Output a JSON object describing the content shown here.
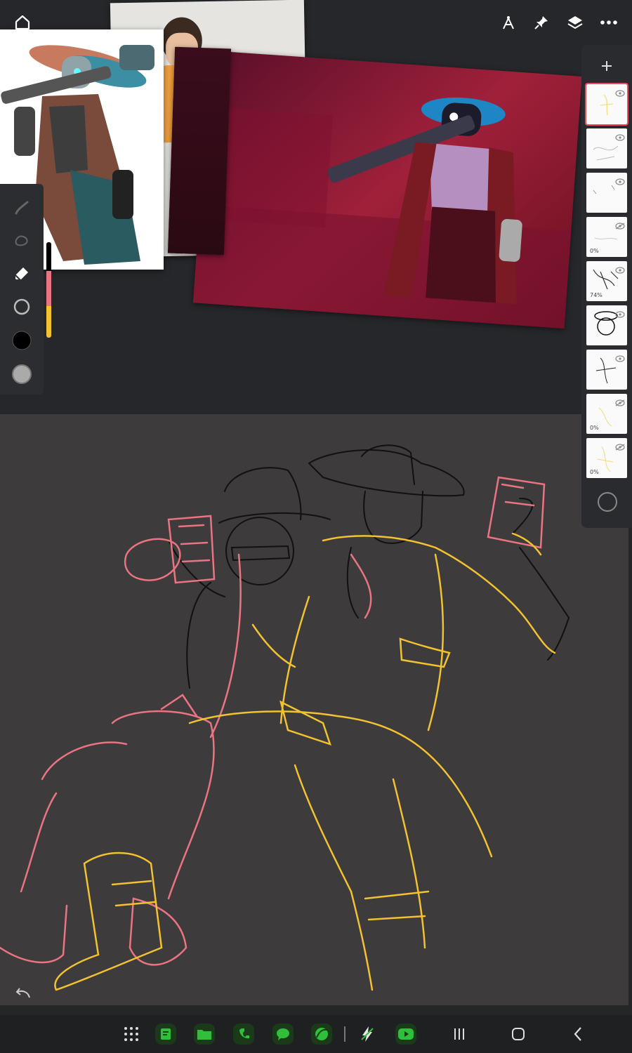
{
  "app": {
    "name": "Drawing app"
  },
  "top_bar": {
    "home_icon": "home-icon",
    "icons": [
      "compass-icon",
      "pin-icon",
      "layers-icon",
      "more-icon"
    ]
  },
  "tools": [
    "brush-icon",
    "smudge-icon",
    "eraser-icon",
    "brush-size-icon",
    "color-black-icon",
    "opacity-icon"
  ],
  "colors": {
    "accent": "#e94e5f",
    "pink": "#ea7482",
    "yellow": "#f2c230",
    "black": "#111111",
    "bg": "#252628",
    "canvas": "#3d3b3c"
  },
  "layers": [
    {
      "selected": true,
      "visible": true,
      "opacity": ""
    },
    {
      "selected": false,
      "visible": true,
      "opacity": ""
    },
    {
      "selected": false,
      "visible": true,
      "opacity": ""
    },
    {
      "selected": false,
      "visible": false,
      "opacity": "0%"
    },
    {
      "selected": false,
      "visible": true,
      "opacity": "74%"
    },
    {
      "selected": false,
      "visible": true,
      "opacity": ""
    },
    {
      "selected": false,
      "visible": true,
      "opacity": ""
    },
    {
      "selected": false,
      "visible": false,
      "opacity": "0%"
    },
    {
      "selected": false,
      "visible": false,
      "opacity": "0%"
    }
  ],
  "layer_panel": {
    "add_icon": "plus-icon",
    "blend_icon": "circle-icon"
  },
  "navbar": {
    "apps": [
      "app-grid-icon",
      "notes-app-icon",
      "files-app-icon",
      "phone-app-icon",
      "messages-app-icon",
      "browser-app-icon",
      "flash-app-icon",
      "youtube-app-icon"
    ],
    "system": [
      "recents-icon",
      "home-button-icon",
      "back-icon"
    ]
  }
}
